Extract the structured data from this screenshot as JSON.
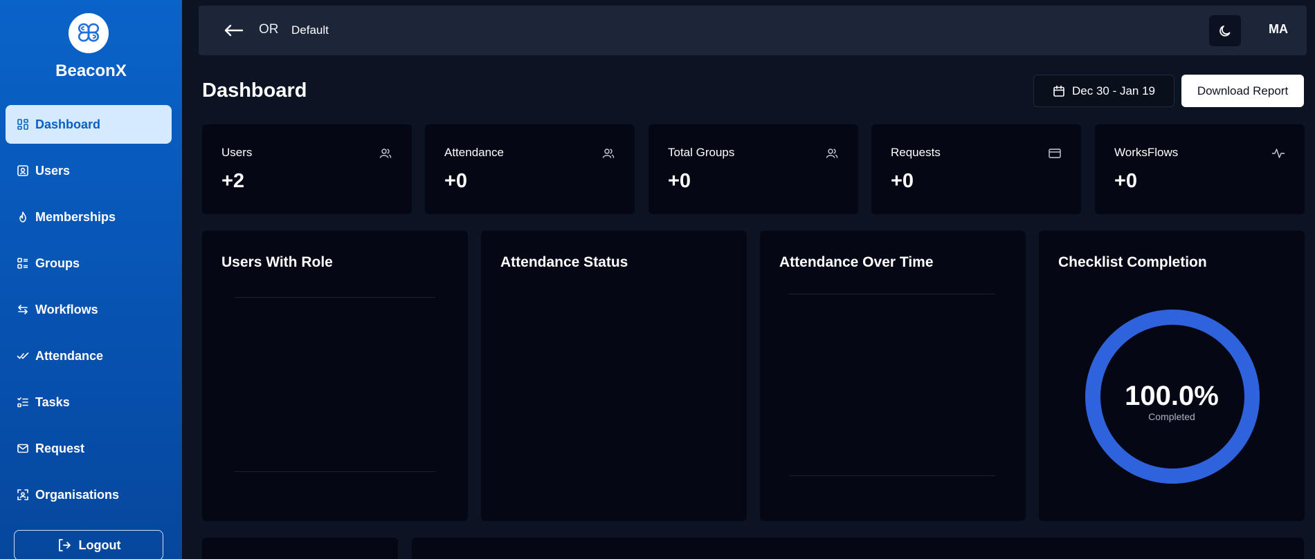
{
  "app": {
    "name": "BeaconX"
  },
  "sidebar": {
    "items": [
      {
        "label": "Dashboard",
        "icon": "dashboard-icon",
        "active": true
      },
      {
        "label": "Users",
        "icon": "user-badge-icon"
      },
      {
        "label": "Memberships",
        "icon": "flame-icon"
      },
      {
        "label": "Groups",
        "icon": "list-grid-icon"
      },
      {
        "label": "Workflows",
        "icon": "arrows-swap-icon"
      },
      {
        "label": "Attendance",
        "icon": "double-check-icon"
      },
      {
        "label": "Tasks",
        "icon": "checklist-icon"
      },
      {
        "label": "Request",
        "icon": "mail-icon"
      },
      {
        "label": "Organisations",
        "icon": "scan-icon"
      }
    ],
    "logout_label": "Logout"
  },
  "topbar": {
    "org_code": "OR",
    "org_name": "Default",
    "avatar_initials": "MA"
  },
  "header": {
    "title": "Dashboard",
    "date_range": "Dec 30 - Jan 19",
    "download_label": "Download Report"
  },
  "stats": [
    {
      "label": "Users",
      "value": "+2",
      "icon": "users-icon"
    },
    {
      "label": "Attendance",
      "value": "+0",
      "icon": "users-icon"
    },
    {
      "label": "Total Groups",
      "value": "+0",
      "icon": "users-icon"
    },
    {
      "label": "Requests",
      "value": "+0",
      "icon": "card-icon"
    },
    {
      "label": "WorksFlows",
      "value": "+0",
      "icon": "activity-icon"
    }
  ],
  "panels": {
    "users_with_role": {
      "title": "Users With Role"
    },
    "attendance_status": {
      "title": "Attendance Status"
    },
    "attendance_over_time": {
      "title": "Attendance Over Time"
    },
    "checklist_completion": {
      "title": "Checklist Completion",
      "percent_label": "100.0%",
      "sub_label": "Completed",
      "completion_fraction": 1.0
    }
  },
  "colors": {
    "accent": "#2f63de",
    "sidebar": "#0a5ec6",
    "active_item_bg": "#d6eafd",
    "card_bg": "#050814",
    "page_bg": "#0c1322"
  }
}
